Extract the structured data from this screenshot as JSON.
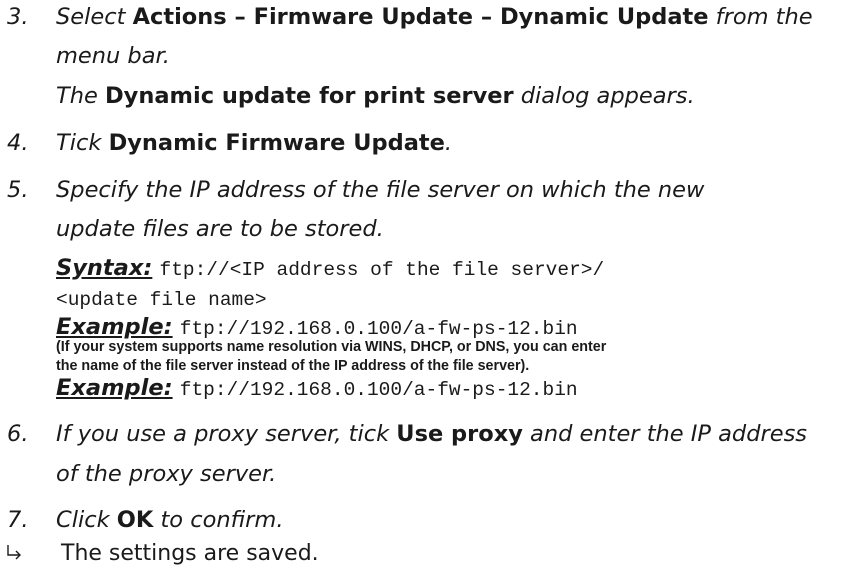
{
  "steps": [
    {
      "num": "3.",
      "line1": {
        "a": "Select ",
        "b1": "Actions – Firmware Update – Dynamic Update",
        "c": " from the"
      },
      "line2": "menu bar.",
      "line3": {
        "a": "The ",
        "b1": "Dynamic update for print server",
        "c": " dialog appears."
      }
    },
    {
      "num": "4.",
      "line1": {
        "a": "Tick ",
        "b1": "Dynamic Firmware Update",
        "c": "."
      }
    },
    {
      "num": "5.",
      "line1": "Specify the IP address of the file server on which the new",
      "line2": "update files are to be stored.",
      "syntax_label": "Syntax:",
      "syntax_code_1": "ftp://<IP address of the file server>/",
      "syntax_code_2": "<update file name>",
      "example_label": "Example:",
      "example_code": "ftp://192.168.0.100/a-fw-ps-12.bin",
      "note_line1": "(If your system supports name resolution via WINS, DHCP, or DNS, you can enter",
      "note_line2": "the name of the file server instead of the IP address of the file server).",
      "example2_label": "Example:",
      "example2_code": "ftp://192.168.0.100/a-fw-ps-12.bin"
    },
    {
      "num": "6.",
      "line1": {
        "a": "If you use a proxy server, tick ",
        "b1": "Use proxy",
        "c": " and enter the IP address"
      },
      "line2": "of the proxy server."
    },
    {
      "num": "7.",
      "line1": {
        "a": "Click ",
        "b1": "OK",
        "c": " to confirm."
      }
    }
  ],
  "result": {
    "icon": "result-arrow-icon",
    "text": "The settings are saved."
  }
}
